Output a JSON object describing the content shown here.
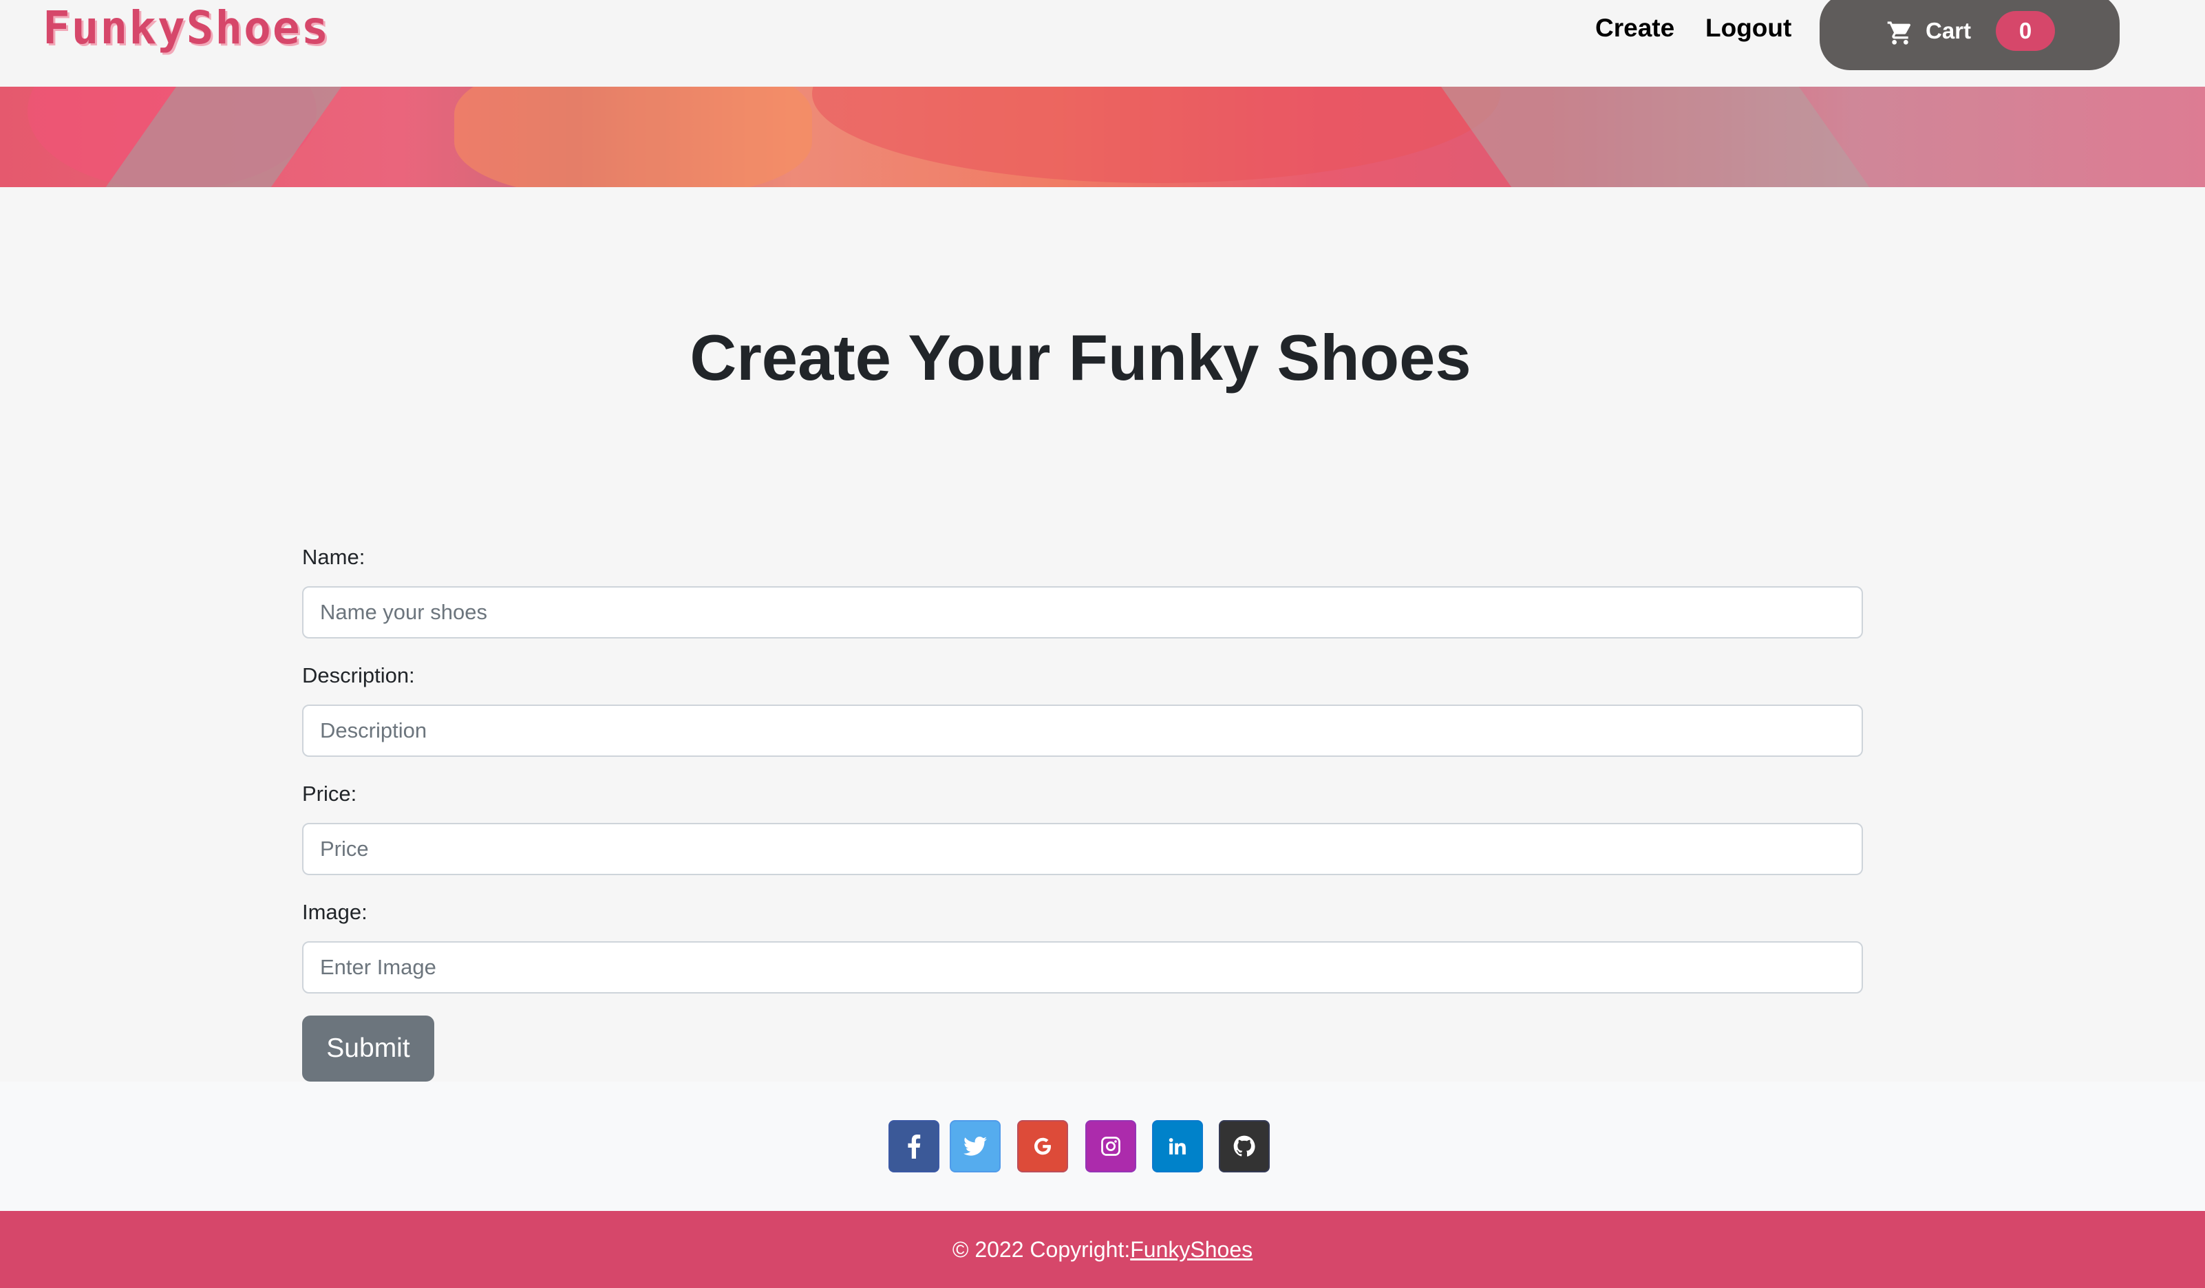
{
  "nav": {
    "brand": "FunkyShoes",
    "links": [
      "Create",
      "Logout"
    ],
    "cart_label": "Cart",
    "cart_count": "0"
  },
  "page": {
    "heading": "Create Your Funky Shoes"
  },
  "form": {
    "fields": [
      {
        "label": "Name:",
        "placeholder": "Name your shoes"
      },
      {
        "label": "Description:",
        "placeholder": "Description"
      },
      {
        "label": "Price:",
        "placeholder": "Price"
      },
      {
        "label": "Image:",
        "placeholder": "Enter Image"
      }
    ],
    "submit_label": "Submit"
  },
  "social": [
    {
      "icon": "facebook-icon",
      "color": "#3b5998"
    },
    {
      "icon": "twitter-icon",
      "color": "#55acee"
    },
    {
      "icon": "google-icon",
      "color": "#dd4b39"
    },
    {
      "icon": "instagram-icon",
      "color": "#ac2bac"
    },
    {
      "icon": "linkedin-icon",
      "color": "#0082ca"
    },
    {
      "icon": "github-icon",
      "color": "#333333"
    }
  ],
  "footer": {
    "copyright": "© 2022 Copyright:",
    "link": "FunkyShoes"
  },
  "colors": {
    "brand": "#d6476a",
    "cart_button": "#5f5c5b",
    "submit_button": "#6c757d"
  }
}
